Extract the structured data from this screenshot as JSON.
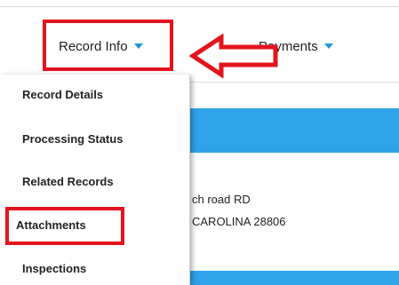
{
  "nav": {
    "tabs": [
      {
        "label": "Record Info"
      },
      {
        "label": "Payments"
      }
    ]
  },
  "dropdown": {
    "items": [
      {
        "label": "Record Details"
      },
      {
        "label": "Processing Status"
      },
      {
        "label": "Related Records"
      },
      {
        "label": "Attachments"
      },
      {
        "label": "Inspections"
      }
    ]
  },
  "content": {
    "address_line_1": "ch road RD",
    "address_line_2": "CAROLINA 28806"
  },
  "colors": {
    "highlight": "#e3141d",
    "accent": "#1a97d8",
    "band": "#2fa3ea"
  },
  "icons": {
    "dropdown_caret": "chevron-down-icon",
    "annotation_arrow": "arrow-left-icon"
  }
}
